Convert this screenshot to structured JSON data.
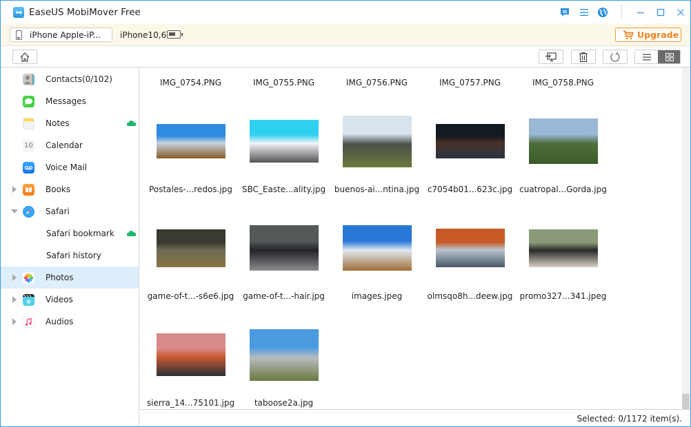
{
  "window": {
    "title": "EaseUS MobiMover Free"
  },
  "titlebar_icons": [
    "feedback-icon",
    "menu-icon",
    "language-globe-icon",
    "minimize-icon",
    "maximize-icon",
    "close-icon"
  ],
  "device": {
    "selector_label": "iPhone Apple-iP...",
    "model": "iPhone10,6",
    "upgrade_label": "Upgrade"
  },
  "colors": {
    "accent": "#3c9be0",
    "upgrade": "#f0841a",
    "selected_row": "#ddeefc",
    "cloud": "#1fb86a",
    "device_bar_bg": "#fcf8e9"
  },
  "toolbar": {
    "buttons": [
      "home",
      "export-to-computer",
      "delete",
      "refresh"
    ],
    "view_mode": "grid"
  },
  "sidebar": {
    "items": [
      {
        "label": "Contacts(0/102)",
        "icon": "contacts-icon",
        "arrow": "none",
        "cloud": false
      },
      {
        "label": "Messages",
        "icon": "messages-icon",
        "arrow": "none",
        "cloud": false
      },
      {
        "label": "Notes",
        "icon": "notes-icon",
        "arrow": "none",
        "cloud": true
      },
      {
        "label": "Calendar",
        "icon": "calendar-icon",
        "arrow": "none",
        "cloud": false,
        "icon_text": "10"
      },
      {
        "label": "Voice Mail",
        "icon": "voicemail-icon",
        "arrow": "none",
        "cloud": false
      },
      {
        "label": "Books",
        "icon": "books-icon",
        "arrow": "collapsed",
        "cloud": false
      },
      {
        "label": "Safari",
        "icon": "safari-icon",
        "arrow": "expanded",
        "cloud": false
      },
      {
        "label": "Safari bookmark",
        "icon": null,
        "arrow": "none",
        "cloud": true,
        "sub": true
      },
      {
        "label": "Safari history",
        "icon": null,
        "arrow": "none",
        "cloud": false,
        "sub": true
      },
      {
        "label": "Photos",
        "icon": "photos-icon",
        "arrow": "collapsed",
        "cloud": false,
        "active": true
      },
      {
        "label": "Videos",
        "icon": "videos-icon",
        "arrow": "collapsed",
        "cloud": false
      },
      {
        "label": "Audios",
        "icon": "audios-icon",
        "arrow": "collapsed",
        "cloud": false
      }
    ]
  },
  "photos": {
    "partial_row": [
      "IMG_0754.PNG",
      "IMG_0755.PNG",
      "IMG_0756.PNG",
      "IMG_0757.PNG",
      "IMG_0758.PNG"
    ],
    "items": [
      {
        "name": "Postales-...redos.jpg",
        "palette": [
          "#2f8be0",
          "#c7d4e2",
          "#8a5a28"
        ]
      },
      {
        "name": "SBC_Easte...ality.jpg",
        "palette": [
          "#2fd0f0",
          "#f2f4f8",
          "#555555"
        ]
      },
      {
        "name": "buenos-ai...ntina.jpg",
        "palette": [
          "#d8e4ec",
          "#4a4f4a",
          "#6b7a3a"
        ]
      },
      {
        "name": "c7054b01...623c.jpg",
        "palette": [
          "#141a22",
          "#4a3028",
          "#2a3440"
        ]
      },
      {
        "name": "cuatropal...Gorda.jpg",
        "palette": [
          "#9ab8d6",
          "#4f6e3c",
          "#3a5a28"
        ]
      },
      {
        "name": "game-of-t...-s6e6.jpg",
        "palette": [
          "#3a3a30",
          "#6b6a55",
          "#8a7440"
        ]
      },
      {
        "name": "game-of-t...-hair.jpg",
        "palette": [
          "#555858",
          "#222428",
          "#8a8c8e"
        ]
      },
      {
        "name": "images.jpeg",
        "palette": [
          "#2878d8",
          "#e0e8f0",
          "#a07038"
        ]
      },
      {
        "name": "olmsqo8h...deew.jpg",
        "palette": [
          "#c85a28",
          "#b8c4d0",
          "#4a5868"
        ]
      },
      {
        "name": "promo327...341.jpeg",
        "palette": [
          "#8a9a78",
          "#2a2a2a",
          "#d8d2c4"
        ]
      },
      {
        "name": "sierra_14...75101.jpg",
        "palette": [
          "#d88a8a",
          "#c85a30",
          "#2a3038"
        ]
      },
      {
        "name": "taboose2a.jpg",
        "palette": [
          "#4a9ae0",
          "#b8bcc0",
          "#6a7a40"
        ]
      }
    ]
  },
  "status": {
    "text": "Selected: 0/1172 item(s)."
  }
}
